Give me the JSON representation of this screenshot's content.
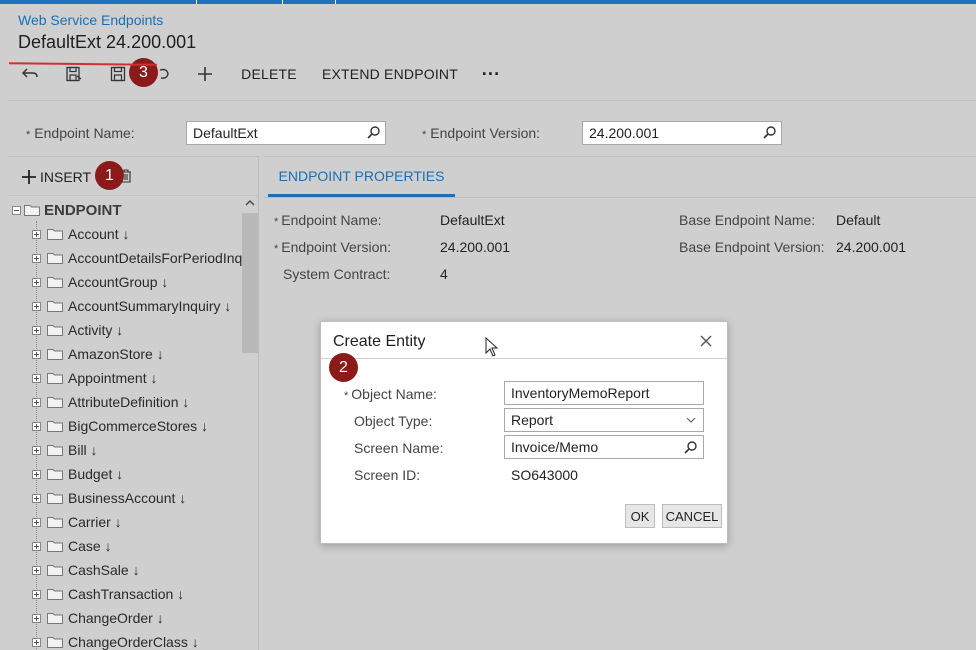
{
  "app": {
    "breadcrumb": "Web Service Endpoints",
    "title": "DefaultExt 24.200.001"
  },
  "toolbar": {
    "delete_label": "DELETE",
    "extend_label": "EXTEND ENDPOINT",
    "more_label": "···",
    "icons": [
      "undo-icon",
      "save-close-icon",
      "save-icon",
      "cancel-icon",
      "add-icon"
    ]
  },
  "form": {
    "endpoint_name_label": "Endpoint Name:",
    "endpoint_name_value": "DefaultExt",
    "endpoint_version_label": "Endpoint Version:",
    "endpoint_version_value": "24.200.001",
    "required_mark": "*"
  },
  "tree": {
    "insert_label": "INSERT",
    "root_label": "ENDPOINT",
    "items": [
      {
        "label": "Account ↓"
      },
      {
        "label": "AccountDetailsForPeriodInquir"
      },
      {
        "label": "AccountGroup ↓"
      },
      {
        "label": "AccountSummaryInquiry ↓"
      },
      {
        "label": "Activity ↓"
      },
      {
        "label": "AmazonStore ↓"
      },
      {
        "label": "Appointment ↓"
      },
      {
        "label": "AttributeDefinition ↓"
      },
      {
        "label": "BigCommerceStores ↓"
      },
      {
        "label": "Bill ↓"
      },
      {
        "label": "Budget ↓"
      },
      {
        "label": "BusinessAccount ↓"
      },
      {
        "label": "Carrier ↓"
      },
      {
        "label": "Case ↓"
      },
      {
        "label": "CashSale ↓"
      },
      {
        "label": "CashTransaction ↓"
      },
      {
        "label": "ChangeOrder ↓"
      },
      {
        "label": "ChangeOrderClass ↓"
      }
    ]
  },
  "properties": {
    "tab_label": "ENDPOINT PROPERTIES",
    "endpoint_name_label": "Endpoint Name:",
    "endpoint_name_value": "DefaultExt",
    "endpoint_version_label": "Endpoint Version:",
    "endpoint_version_value": "24.200.001",
    "system_contract_label": "System Contract:",
    "system_contract_value": "4",
    "base_name_label": "Base Endpoint Name:",
    "base_name_value": "Default",
    "base_version_label": "Base Endpoint Version:",
    "base_version_value": "24.200.001"
  },
  "dialog": {
    "title": "Create Entity",
    "object_name_label": "Object Name:",
    "object_name_value": "InventoryMemoReport",
    "object_type_label": "Object Type:",
    "object_type_value": "Report",
    "screen_name_label": "Screen Name:",
    "screen_name_value": "Invoice/Memo",
    "screen_id_label": "Screen ID:",
    "screen_id_value": "SO643000",
    "ok_label": "OK",
    "cancel_label": "CANCEL"
  },
  "markers": [
    "1",
    "2",
    "3"
  ],
  "colors": {
    "accent": "#1a6fb5",
    "marker": "#8b1a1a",
    "background": "#cfcfcf",
    "underline": "#d03030"
  }
}
